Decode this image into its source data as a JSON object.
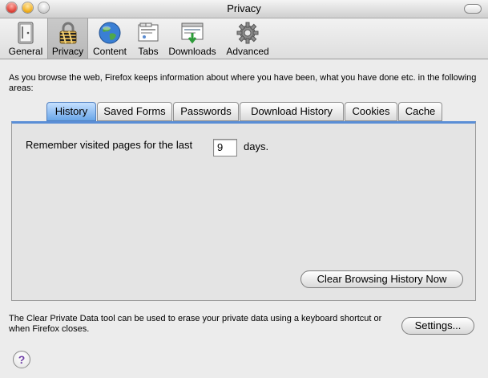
{
  "window": {
    "title": "Privacy"
  },
  "toolbar": {
    "items": [
      {
        "label": "General",
        "icon": "general-icon"
      },
      {
        "label": "Privacy",
        "icon": "lock-icon",
        "selected": true
      },
      {
        "label": "Content",
        "icon": "globe-icon"
      },
      {
        "label": "Tabs",
        "icon": "tabs-icon"
      },
      {
        "label": "Downloads",
        "icon": "downloads-icon"
      },
      {
        "label": "Advanced",
        "icon": "gear-icon"
      }
    ]
  },
  "intro": "As you browse the web, Firefox keeps information about where you have been, what you have done etc. in the following areas:",
  "tabs": [
    "History",
    "Saved Forms",
    "Passwords",
    "Download History",
    "Cookies",
    "Cache"
  ],
  "active_tab": "History",
  "history": {
    "remember_label": "Remember visited pages for the last",
    "days_value": "9",
    "days_label": "days.",
    "clear_button": "Clear Browsing History Now"
  },
  "footer": {
    "text": "The Clear Private Data tool can be used to erase your private data using a keyboard shortcut or when Firefox closes.",
    "settings_button": "Settings...",
    "help_label": "?"
  },
  "colors": {
    "accent": "#5a8ed6",
    "active_tab": "#6aa6e8"
  }
}
